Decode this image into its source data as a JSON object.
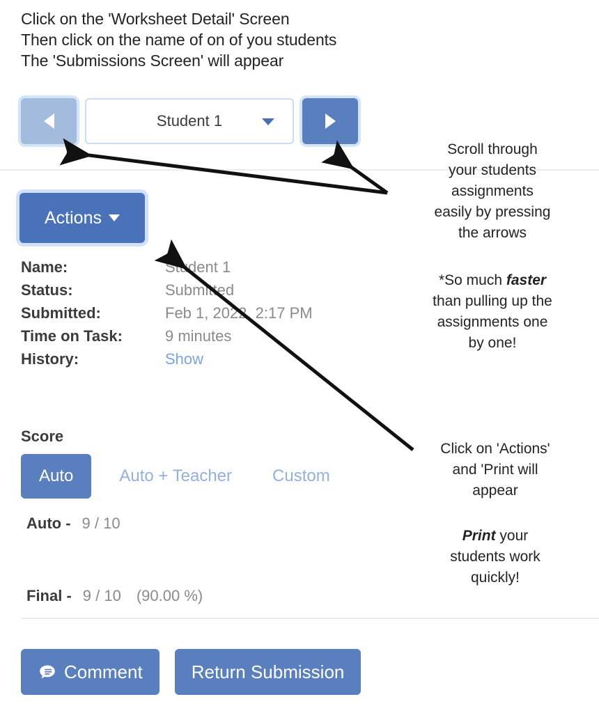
{
  "instructions": [
    "Click on the 'Worksheet Detail' Screen",
    "Then click on the name of on of you students",
    "The 'Submissions Screen' will appear"
  ],
  "nav": {
    "prev_icon": "triangle-left-icon",
    "next_icon": "triangle-right-icon",
    "selected_student": "Student 1",
    "caret_icon": "chevron-down-icon"
  },
  "actions": {
    "label": "Actions",
    "caret_icon": "caret-down-icon"
  },
  "details": [
    {
      "label": "Name:",
      "value": "Student 1",
      "link": false
    },
    {
      "label": "Status:",
      "value": "Submitted",
      "link": false
    },
    {
      "label": "Submitted:",
      "value": "Feb 1, 2022, 2:17 PM",
      "link": false
    },
    {
      "label": "Time on Task:",
      "value": "9 minutes",
      "link": false
    },
    {
      "label": "History:",
      "value": "Show",
      "link": true
    }
  ],
  "score": {
    "title": "Score",
    "tabs": [
      {
        "label": "Auto",
        "active": true
      },
      {
        "label": "Auto + Teacher",
        "active": false
      },
      {
        "label": "Custom",
        "active": false
      }
    ],
    "auto": {
      "key": "Auto -",
      "value": "9 / 10",
      "percent": ""
    },
    "final": {
      "key": "Final -",
      "value": "9 / 10",
      "percent": "(90.00 %)"
    }
  },
  "bottom_buttons": {
    "comment": {
      "label": "Comment",
      "icon": "comment-bubble-icon"
    },
    "return": {
      "label": "Return Submission"
    }
  },
  "notes": {
    "scroll": {
      "lines": [
        "Scroll through",
        "your students",
        "assignments",
        "easily by pressing",
        "the arrows"
      ]
    },
    "faster": {
      "prefix": "*So much ",
      "emphasis": "faster",
      "rest": [
        "than pulling up the",
        "assignments one",
        "by one!"
      ]
    },
    "actions": {
      "lines": [
        "Click on 'Actions'",
        "and 'Print will",
        "appear"
      ]
    },
    "print": {
      "emphasis": "Print",
      "suffix": " your",
      "rest": [
        "students work",
        "quickly!"
      ]
    }
  },
  "colors": {
    "primary_blue": "#5a7fbf",
    "actions_blue": "#4a72b8",
    "disabled_blue": "#a3bbdd",
    "tab_inactive": "#93b0e0",
    "link_blue": "#7ba4e8",
    "value_gray": "#8a8a8a",
    "divider": "#ededed"
  }
}
